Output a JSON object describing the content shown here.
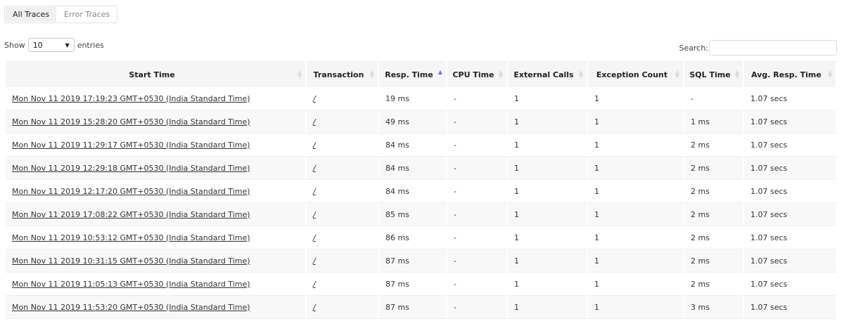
{
  "tabs": [
    {
      "label": "All Traces",
      "active": true
    },
    {
      "label": "Error Traces",
      "active": false
    }
  ],
  "length": {
    "show": "Show",
    "value": "10",
    "entries": "entries"
  },
  "search": {
    "label": "Search:",
    "value": ""
  },
  "columns": [
    "Start Time",
    "Transaction",
    "Resp. Time",
    "CPU Time",
    "External Calls",
    "Exception Count",
    "SQL Time",
    "Avg. Resp. Time"
  ],
  "sorted_column": "Resp. Time",
  "sort_direction": "ascending",
  "sort_color": "#7076d8",
  "rows": [
    [
      "Mon Nov 11 2019 17:19:23 GMT+0530 (India Standard Time)",
      "/",
      "19 ms",
      "-",
      "1",
      "1",
      "-",
      "1.07 secs"
    ],
    [
      "Mon Nov 11 2019 15:28:20 GMT+0530 (India Standard Time)",
      "/",
      "49 ms",
      "-",
      "1",
      "1",
      "1 ms",
      "1.07 secs"
    ],
    [
      "Mon Nov 11 2019 11:29:17 GMT+0530 (India Standard Time)",
      "/",
      "84 ms",
      "-",
      "1",
      "1",
      "2 ms",
      "1.07 secs"
    ],
    [
      "Mon Nov 11 2019 12:29:18 GMT+0530 (India Standard Time)",
      "/",
      "84 ms",
      "-",
      "1",
      "1",
      "2 ms",
      "1.07 secs"
    ],
    [
      "Mon Nov 11 2019 12:17:20 GMT+0530 (India Standard Time)",
      "/",
      "84 ms",
      "-",
      "1",
      "1",
      "2 ms",
      "1.07 secs"
    ],
    [
      "Mon Nov 11 2019 17:08:22 GMT+0530 (India Standard Time)",
      "/",
      "85 ms",
      "-",
      "1",
      "1",
      "2 ms",
      "1.07 secs"
    ],
    [
      "Mon Nov 11 2019 10:53:12 GMT+0530 (India Standard Time)",
      "/",
      "86 ms",
      "-",
      "1",
      "1",
      "2 ms",
      "1.07 secs"
    ],
    [
      "Mon Nov 11 2019 10:31:15 GMT+0530 (India Standard Time)",
      "/",
      "87 ms",
      "-",
      "1",
      "1",
      "2 ms",
      "1.07 secs"
    ],
    [
      "Mon Nov 11 2019 11:05:13 GMT+0530 (India Standard Time)",
      "/",
      "87 ms",
      "-",
      "1",
      "1",
      "2 ms",
      "1.07 secs"
    ],
    [
      "Mon Nov 11 2019 11:53:20 GMT+0530 (India Standard Time)",
      "/",
      "87 ms",
      "-",
      "1",
      "1",
      "3 ms",
      "1.07 secs"
    ]
  ]
}
